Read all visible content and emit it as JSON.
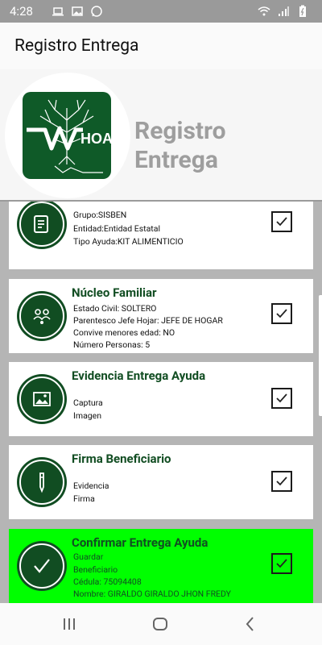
{
  "status_bar": {
    "time": "4:28"
  },
  "app_bar": {
    "title": "Registro Entrega"
  },
  "header": {
    "logo_text": "HOAK",
    "title_line1": "Registro",
    "title_line2": "Entrega"
  },
  "cards": [
    {
      "title": "",
      "lines": [
        "Grupo:SISBEN",
        "Entidad:Entidad Estatal",
        "Tipo Ayuda:KIT ALIMENTICIO"
      ],
      "icon": "document-icon"
    },
    {
      "title": "Núcleo Familiar",
      "lines": [
        "Estado Civil: SOLTERO",
        "Parentesco Jefe Hojar: JEFE DE HOGAR",
        "Convive menores edad: NO",
        "Número Personas: 5"
      ],
      "icon": "family-icon"
    },
    {
      "title": "Evidencia Entrega Ayuda",
      "lines": [
        "Captura",
        "Imagen"
      ],
      "icon": "image-icon"
    },
    {
      "title": "Firma Beneficiario",
      "lines": [
        "Evidencia",
        "Firma"
      ],
      "icon": "pen-icon"
    },
    {
      "title": "Confirmar Entrega Ayuda",
      "lines": [
        "Guardar",
        "Beneficiario",
        "Cédula: 75094408",
        "Nombre: GIRALDO GIRALDO JHON FREDY"
      ],
      "icon": "confirm-check-icon"
    }
  ],
  "colors": {
    "brand_green": "#114d22",
    "highlight_green": "#00ff00"
  }
}
